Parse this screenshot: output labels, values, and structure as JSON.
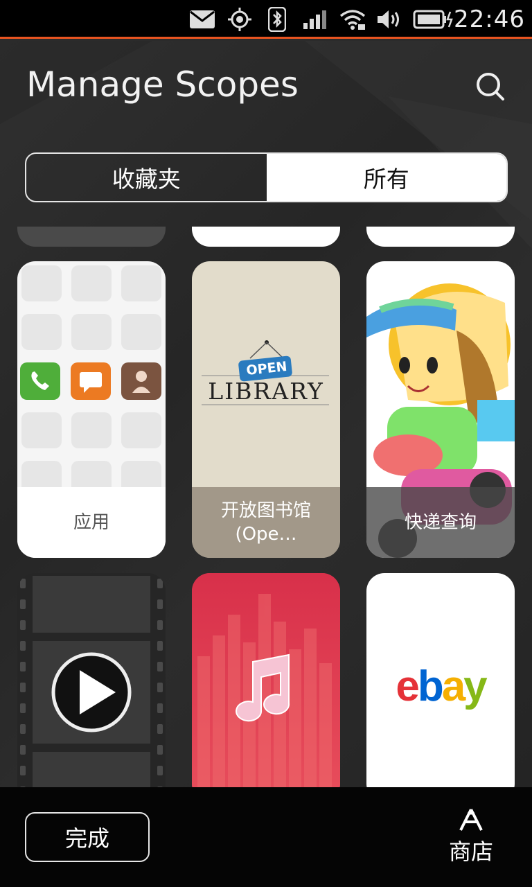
{
  "status_bar": {
    "time": "22:46",
    "icons": [
      "mail-icon",
      "location-icon",
      "bluetooth-icon",
      "signal-icon",
      "wifi-icon",
      "volume-icon",
      "battery-charging-icon"
    ]
  },
  "header": {
    "title": "Manage Scopes",
    "search_icon": "search-icon"
  },
  "tabs": [
    {
      "label": "收藏夹",
      "active": false
    },
    {
      "label": "所有",
      "active": true
    }
  ],
  "scopes": [
    {
      "label": "应用",
      "icon": "apps-grid-icon",
      "bg": "#f5f5f5"
    },
    {
      "label": "开放图书馆 (Ope…",
      "icon": "open-library-logo",
      "bg": "#e2dccb",
      "logo_badge": "OPEN",
      "logo_text": "LIBRARY"
    },
    {
      "label": "快递查询",
      "icon": "courier-delivery-icon",
      "bg": "#ffffff"
    },
    {
      "label": "",
      "icon": "video-play-icon",
      "bg": "#2a2a2a"
    },
    {
      "label": "",
      "icon": "music-note-icon",
      "bg": "#e0384f"
    },
    {
      "label": "",
      "icon": "ebay-logo",
      "bg": "#ffffff",
      "logo_text": "ebay"
    }
  ],
  "colors": {
    "accent": "#e95420",
    "background": "#2b2b2b"
  },
  "bottom_bar": {
    "done_label": "完成",
    "store_label": "商店",
    "store_icon": "store-icon"
  }
}
